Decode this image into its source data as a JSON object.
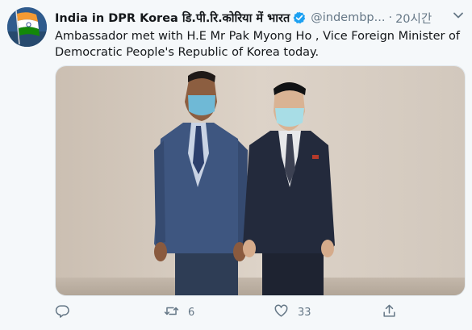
{
  "tweet": {
    "display_name": "India in DPR Korea डि.पी.रि.कोरिया में भारत",
    "handle": "@indembp...",
    "separator": "·",
    "time": "20시간",
    "text": "Ambassador met with H.E Mr  Pak Myong Ho , Vice Foreign Minister of Democratic People's Republic of Korea today.",
    "icons": {
      "avatar": "india-flag-avatar",
      "verified": "verified-badge-icon",
      "more": "chevron-down-icon",
      "reply": "reply-icon",
      "retweet": "retweet-icon",
      "like": "heart-icon",
      "share": "share-icon"
    },
    "counts": {
      "reply": "",
      "retweet": "6",
      "like": "33"
    },
    "colors": {
      "verified": "#1da1f2",
      "meta": "#657786",
      "flag_saffron": "#f49a33",
      "flag_green": "#138808"
    }
  }
}
